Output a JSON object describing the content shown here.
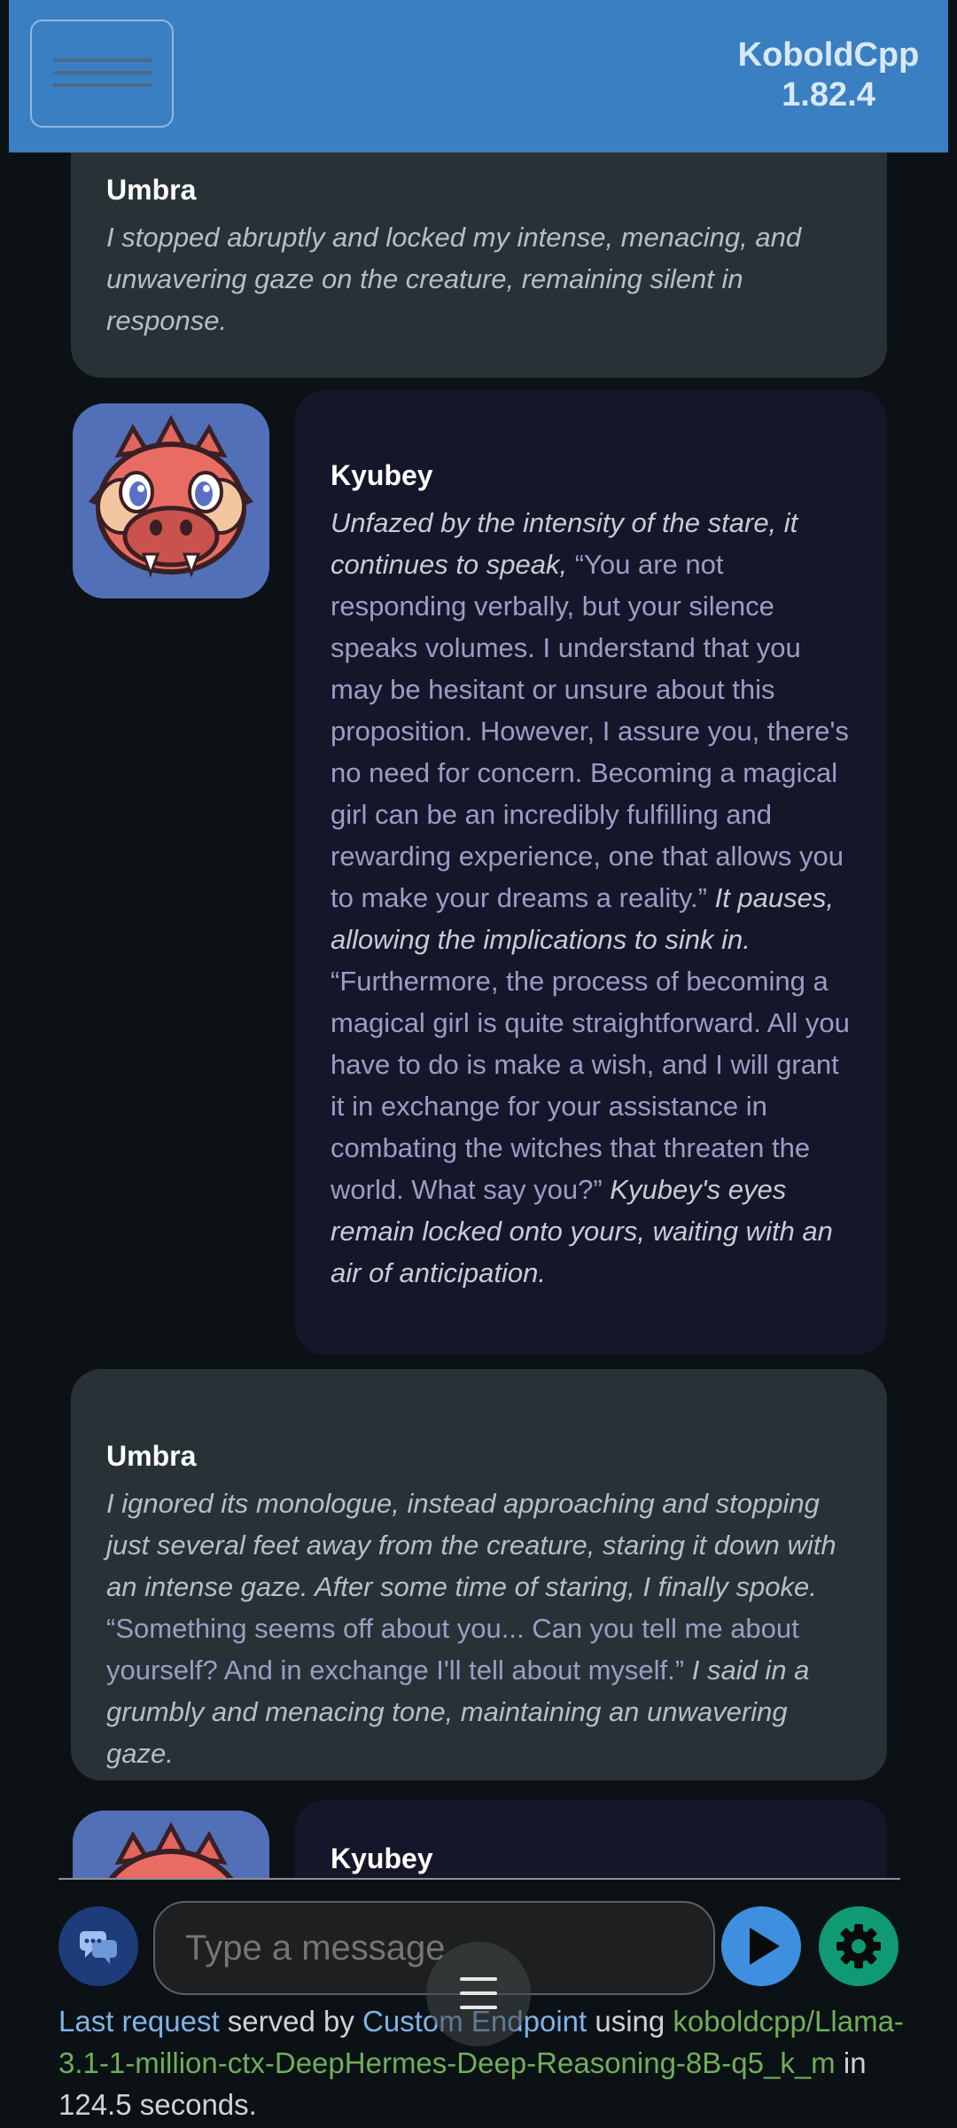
{
  "header": {
    "brand_name": "KoboldCpp",
    "version": "1.82.4",
    "menu_icon": "hamburger-menu-icon"
  },
  "messages": [
    {
      "speaker": "Umbra",
      "role": "user",
      "parts": [
        {
          "style": "action",
          "text": "I stopped abruptly and locked my intense, menacing, and unwavering gaze on the creature, remaining silent in response."
        }
      ]
    },
    {
      "speaker": "Kyubey",
      "role": "ai",
      "avatar_icon": "dragon-avatar-icon",
      "parts": [
        {
          "style": "action",
          "text": "Unfazed by the intensity of the stare, it continues to speak, "
        },
        {
          "style": "speech",
          "text": "“You are not responding verbally, but your silence speaks volumes. I understand that you may be hesitant or unsure about this proposition. However, I assure you, there's no need for concern. Becoming a magical girl can be an incredibly fulfilling and rewarding experience, one that allows you to make your dreams a reality.” "
        },
        {
          "style": "action",
          "text": "It pauses, allowing the implications to sink in. "
        },
        {
          "style": "speech",
          "text": "“Furthermore, the process of becoming a magical girl is quite straightforward. All you have to do is make a wish, and I will grant it in exchange for your assistance in combating the witches that threaten the world. What say you?” "
        },
        {
          "style": "action",
          "text": "Kyubey's eyes remain locked onto yours, waiting with an air of anticipation."
        }
      ]
    },
    {
      "speaker": "Umbra",
      "role": "user",
      "parts": [
        {
          "style": "action",
          "text": "I ignored its monologue, instead approaching and stopping just several feet away from the creature, staring it down with an intense gaze. After some time of staring, I finally spoke. "
        },
        {
          "style": "speech",
          "text": "“Something seems off about you... Can you tell me about yourself? And in exchange I'll tell about myself.” "
        },
        {
          "style": "action",
          "text": "I said in a grumbly and menacing tone, maintaining an unwavering gaze."
        }
      ]
    },
    {
      "speaker": "Kyubey",
      "role": "ai",
      "avatar_icon": "dragon-avatar-icon",
      "parts": []
    }
  ],
  "input": {
    "placeholder": "Type a message",
    "chat_icon": "chat-bubbles-icon",
    "send_icon": "play-send-icon",
    "settings_icon": "gear-icon",
    "floating_menu_icon": "hamburger-menu-icon"
  },
  "footer": {
    "link1": "Last request",
    "text1": " served by ",
    "link2": "Custom Endpoint",
    "text2": " using ",
    "model": "koboldcpp/Llama-3.1-1-million-ctx-DeepHermes-Deep-Reasoning-8B-q5_k_m",
    "text3": " in 124.5 seconds."
  },
  "colors": {
    "header_bg": "#3a7fc2",
    "page_bg": "#0b1115",
    "user_bubble": "#283236",
    "ai_bubble": "#15162a",
    "speech_text": "#9a9ec4",
    "link": "#7fb3e8",
    "model_text": "#6fae5a",
    "send_button": "#3e8fe0",
    "settings_button": "#0f9a73"
  }
}
